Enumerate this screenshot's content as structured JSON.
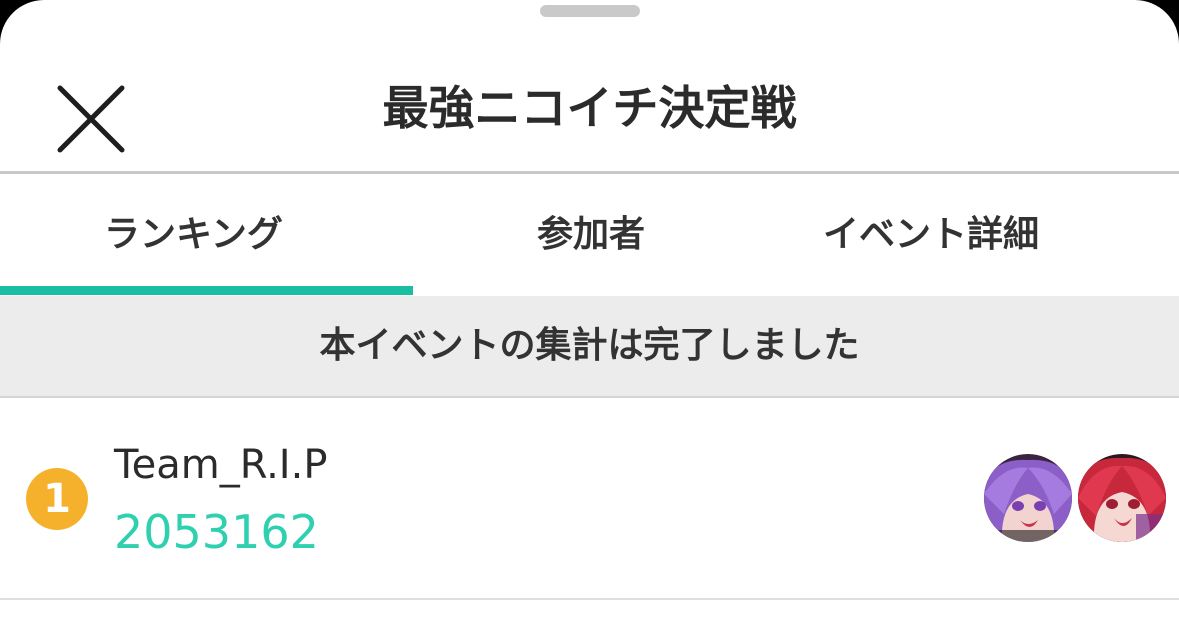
{
  "header": {
    "title": "最強ニコイチ決定戦"
  },
  "tabs": [
    {
      "label": "ランキング",
      "active": true
    },
    {
      "label": "参加者",
      "active": false
    },
    {
      "label": "イベント詳細",
      "active": false
    }
  ],
  "banner": {
    "text": "本イベントの集計は完了しました"
  },
  "ranking": [
    {
      "rank": "1",
      "team": "Team_R.I.P",
      "score": "2053162",
      "avatars": [
        "avatar-purple-hair",
        "avatar-red-hair"
      ]
    }
  ],
  "colors": {
    "accent": "#19bfa0",
    "score": "#2fd0b0",
    "rank_gold": "#f6b12c",
    "banner_bg": "#ececec"
  },
  "icons": {
    "close": "close-icon"
  }
}
